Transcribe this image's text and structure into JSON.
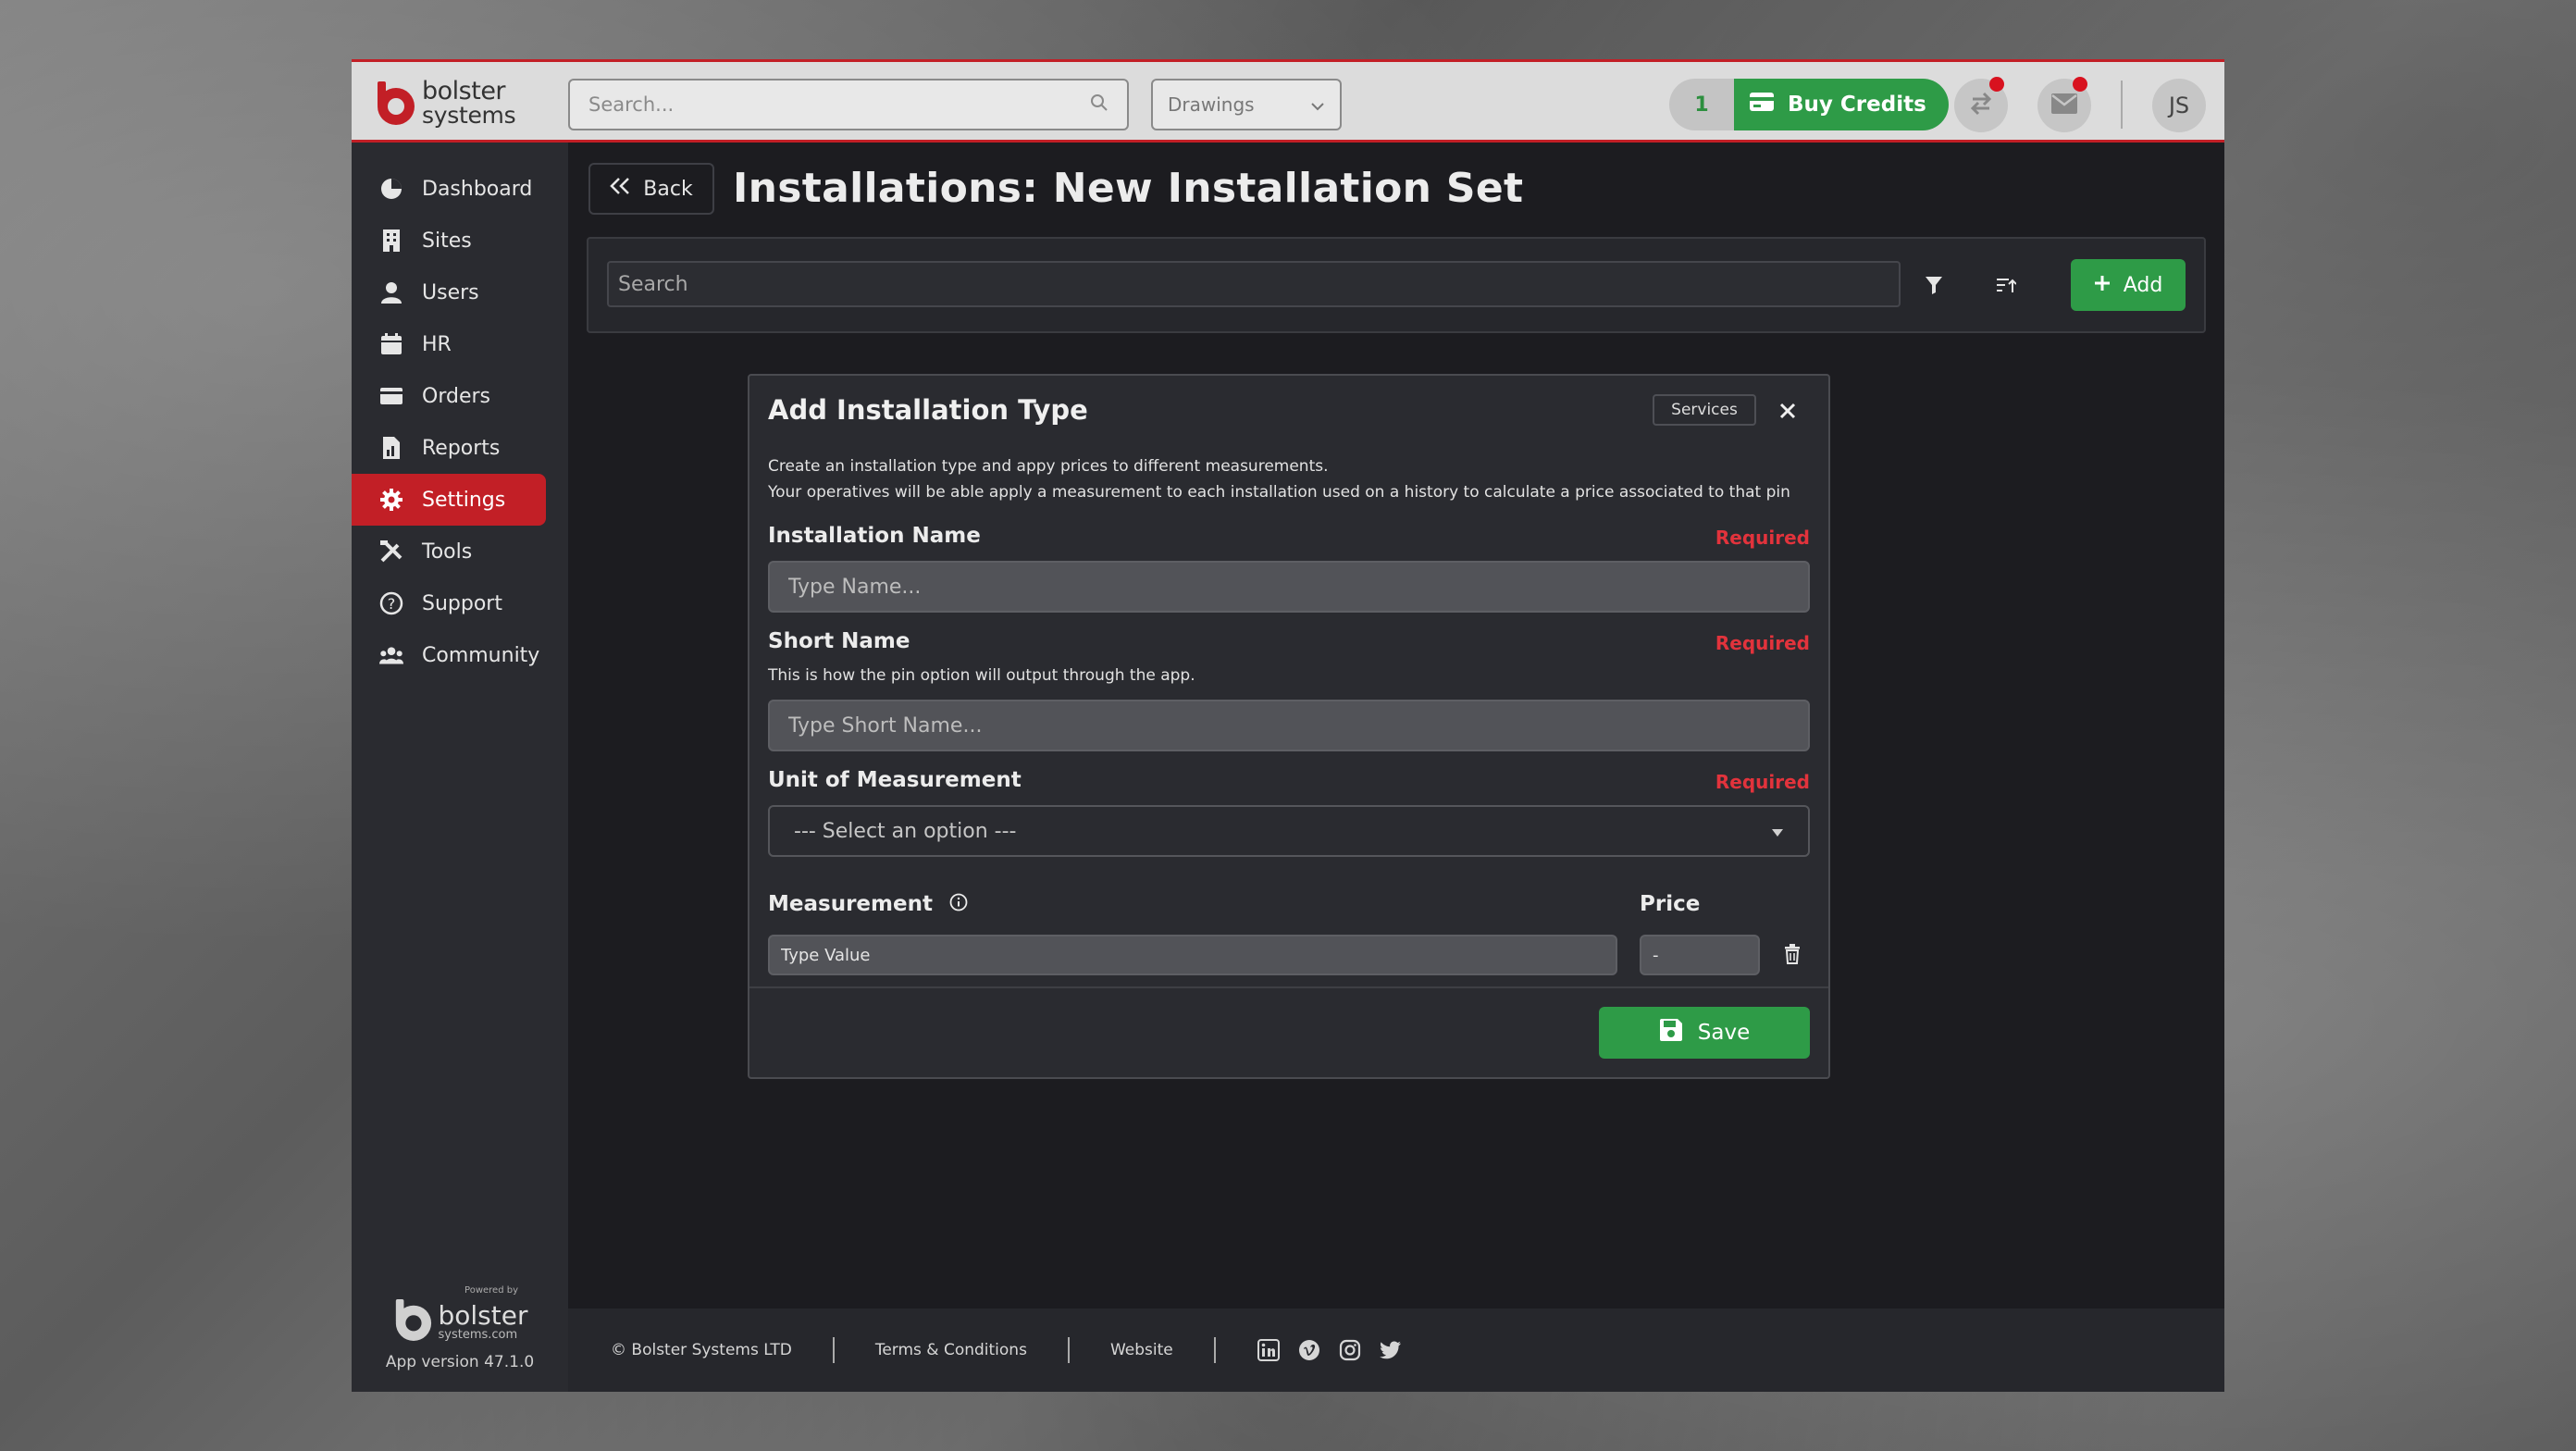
{
  "brand": {
    "line1": "bolster",
    "line2": "systems"
  },
  "topbar": {
    "search_placeholder": "Search...",
    "drawings_label": "Drawings",
    "credits_count": "1",
    "buy_credits_label": "Buy Credits",
    "avatar_initials": "JS"
  },
  "sidebar": {
    "items": [
      {
        "label": "Dashboard",
        "icon": "dashboard-pie-icon"
      },
      {
        "label": "Sites",
        "icon": "building-icon"
      },
      {
        "label": "Users",
        "icon": "user-icon"
      },
      {
        "label": "HR",
        "icon": "calendar-icon"
      },
      {
        "label": "Orders",
        "icon": "card-icon"
      },
      {
        "label": "Reports",
        "icon": "report-icon"
      },
      {
        "label": "Settings",
        "icon": "gear-icon"
      },
      {
        "label": "Tools",
        "icon": "tools-icon"
      },
      {
        "label": "Support",
        "icon": "question-icon"
      },
      {
        "label": "Community",
        "icon": "community-icon"
      }
    ],
    "active_index": 6,
    "footer": {
      "powered_by": "Powered by",
      "logo_line1": "bolster",
      "logo_line2": "systems.com",
      "version": "App version 47.1.0"
    }
  },
  "header": {
    "back_label": "Back",
    "title": "Installations: New Installation Set"
  },
  "toolbar": {
    "search_placeholder": "Search",
    "add_label": "Add"
  },
  "modal": {
    "title": "Add Installation Type",
    "badge": "Services",
    "description_line1": "Create an installation type and appy prices to different measurements.",
    "description_line2": "Your operatives will be able apply a measurement to each installation used on a history to calculate a price associated to that pin",
    "installation_name": {
      "label": "Installation Name",
      "required": "Required",
      "placeholder": "Type Name..."
    },
    "short_name": {
      "label": "Short Name",
      "required": "Required",
      "help": "This is how the pin option will output through the app.",
      "placeholder": "Type Short Name..."
    },
    "unit": {
      "label": "Unit of Measurement",
      "required": "Required",
      "selected": "--- Select an option ---"
    },
    "measurement": {
      "label": "Measurement",
      "value_placeholder": "Type Value"
    },
    "price": {
      "label": "Price",
      "placeholder": "-"
    },
    "save_label": "Save"
  },
  "footer": {
    "copyright": "© Bolster Systems LTD",
    "terms": "Terms & Conditions",
    "website": "Website",
    "social": [
      "linkedin-icon",
      "vimeo-icon",
      "instagram-icon",
      "twitter-icon"
    ]
  },
  "colors": {
    "accent_red": "#c21f26",
    "accent_green": "#2e9b47",
    "required_red": "#e2333c"
  }
}
